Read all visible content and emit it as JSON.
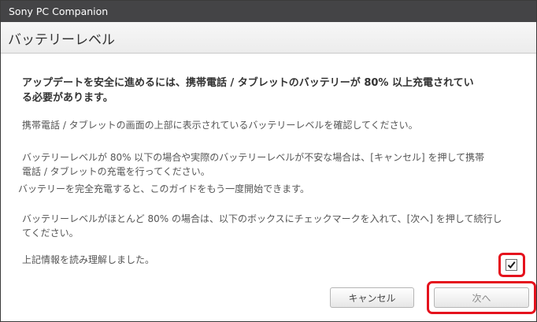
{
  "window": {
    "title": "Sony PC Companion"
  },
  "header": {
    "title": "バッテリーレベル"
  },
  "content": {
    "lead": "アップデートを安全に進めるには、携帯電話 / タブレットのバッテリーが 80% 以上充電されている必要があります。",
    "p1": "携帯電話 / タブレットの画面の上部に表示されているバッテリーレベルを確認してください。",
    "p2": "バッテリーレベルが 80% 以下の場合や実際のバッテリーレベルが不安な場合は、[キャンセル] を押して携帯電話 / タブレットの充電を行ってください。",
    "p3": "バッテリーを完全充電すると、このガイドをもう一度開始できます。",
    "p4": "バッテリーレベルがほとんど 80% の場合は、以下のボックスにチェックマークを入れて、[次へ] を押して続行してください。",
    "confirm_label": "上記情報を読み理解しました。",
    "confirm_checked": true
  },
  "buttons": {
    "cancel": "キャンセル",
    "next": "次へ"
  },
  "colors": {
    "titlebar": "#444446",
    "highlight": "#e5121d",
    "check": "#1a1a1a"
  }
}
